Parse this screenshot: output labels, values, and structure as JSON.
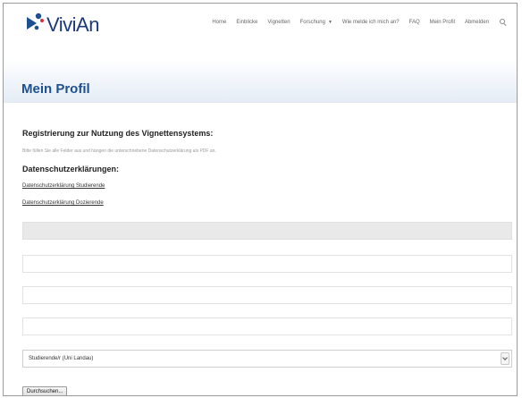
{
  "header": {
    "logo_text": "ViviAn",
    "nav": [
      {
        "label": "Home"
      },
      {
        "label": "Einblicke"
      },
      {
        "label": "Vignetten"
      },
      {
        "label": "Forschung",
        "dropdown": true
      },
      {
        "label": "Wie melde ich mich an?"
      },
      {
        "label": "FAQ"
      },
      {
        "label": "Mein Profil"
      },
      {
        "label": "Abmelden"
      }
    ],
    "search_icon": "search-icon"
  },
  "page": {
    "title": "Mein Profil"
  },
  "form": {
    "heading": "Registrierung zur Nutzung des Vignettensystems:",
    "hint": "Bitte füllen Sie alle Felder aus und hängen die unterschriebene Datenschutzerklärung als PDF an.",
    "privacy_heading": "Datenschutzerklärungen:",
    "privacy_links": [
      "Datenschutzerklärung Studierende",
      "Datenschutzerklärung Dozierende"
    ],
    "email_value": "",
    "role_select": {
      "value": "Studierende/r (Uni Landau)"
    },
    "browse_label": "Durchsuchen..."
  },
  "colors": {
    "title": "#1d4f91",
    "logo_text": "#1a3a7a",
    "logo_icon": "#1d4f91",
    "logo_accent": "#d6303a"
  }
}
